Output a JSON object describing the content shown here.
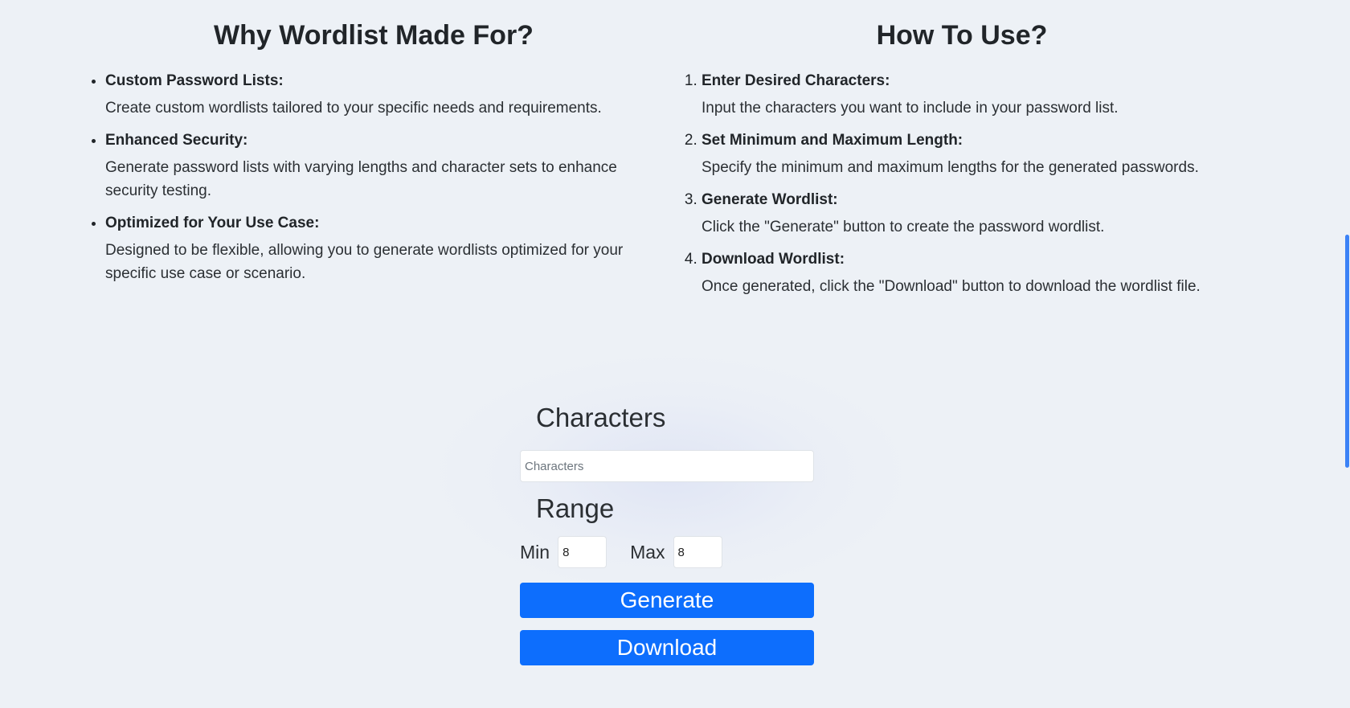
{
  "why": {
    "title": "Why Wordlist Made For?",
    "items": [
      {
        "title": "Custom Password Lists:",
        "desc": "Create custom wordlists tailored to your specific needs and requirements."
      },
      {
        "title": "Enhanced Security:",
        "desc": "Generate password lists with varying lengths and character sets to enhance security testing."
      },
      {
        "title": "Optimized for Your Use Case:",
        "desc": "Designed to be flexible, allowing you to generate wordlists optimized for your specific use case or scenario."
      }
    ]
  },
  "how": {
    "title": "How To Use?",
    "steps": [
      {
        "title": "Enter Desired Characters:",
        "desc": "Input the characters you want to include in your password list."
      },
      {
        "title": "Set Minimum and Maximum Length:",
        "desc": "Specify the minimum and maximum lengths for the generated passwords."
      },
      {
        "title": "Generate Wordlist:",
        "desc": "Click the \"Generate\" button to create the password wordlist."
      },
      {
        "title": "Download Wordlist:",
        "desc": "Once generated, click the \"Download\" button to download the wordlist file."
      }
    ]
  },
  "form": {
    "characters_label": "Characters",
    "characters_value": "",
    "characters_placeholder": "Characters",
    "range_label": "Range",
    "min_label": "Min",
    "min_value": "8",
    "max_label": "Max",
    "max_value": "8",
    "generate_label": "Generate",
    "download_label": "Download"
  },
  "colors": {
    "background": "#edf1f6",
    "accent": "#0d6efd",
    "scrollbar": "#3b82f6"
  }
}
